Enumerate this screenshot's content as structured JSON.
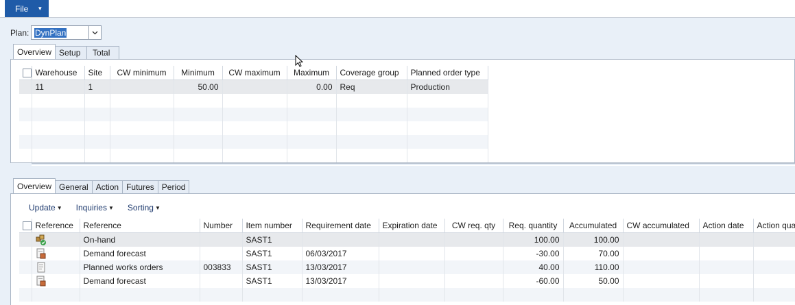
{
  "menu": {
    "file_label": "File"
  },
  "plan": {
    "label": "Plan:",
    "value": "DynPlan"
  },
  "top_tabs": [
    "Overview",
    "Setup",
    "Total"
  ],
  "coverage_grid": {
    "columns": [
      "Warehouse",
      "Site",
      "CW minimum",
      "Minimum",
      "CW maximum",
      "Maximum",
      "Coverage group",
      "Planned order type"
    ],
    "rows": [
      {
        "warehouse": "11",
        "site": "1",
        "cw_minimum": "",
        "minimum": "50.00",
        "cw_maximum": "",
        "maximum": "0.00",
        "coverage_group": "Req",
        "planned_order_type": "Production"
      }
    ]
  },
  "bottom_tabs": [
    "Overview",
    "General",
    "Action",
    "Futures",
    "Period"
  ],
  "toolbar": {
    "update": "Update",
    "inquiries": "Inquiries",
    "sorting": "Sorting"
  },
  "transactions_grid": {
    "columns": [
      "Reference",
      "Reference",
      "Number",
      "Item number",
      "Requirement date",
      "Expiration date",
      "CW req. qty",
      "Req. quantity",
      "Accumulated",
      "CW accumulated",
      "Action date",
      "Action quar"
    ],
    "rows": [
      {
        "icon": "on-hand-icon",
        "reference": "On-hand",
        "number": "",
        "item": "SAST1",
        "req_date": "",
        "exp_date": "",
        "cw_qty": "",
        "req_qty": "100.00",
        "accumulated": "100.00",
        "cw_acc": "",
        "action_date": "",
        "action_qty": ""
      },
      {
        "icon": "demand-forecast-icon",
        "reference": "Demand forecast",
        "number": "",
        "item": "SAST1",
        "req_date": "06/03/2017",
        "exp_date": "",
        "cw_qty": "",
        "req_qty": "-30.00",
        "accumulated": "70.00",
        "cw_acc": "",
        "action_date": "",
        "action_qty": ""
      },
      {
        "icon": "planned-works-order-icon",
        "reference": "Planned works orders",
        "number": "003833",
        "item": "SAST1",
        "req_date": "13/03/2017",
        "exp_date": "",
        "cw_qty": "",
        "req_qty": "40.00",
        "accumulated": "110.00",
        "cw_acc": "",
        "action_date": "",
        "action_qty": ""
      },
      {
        "icon": "demand-forecast-icon",
        "reference": "Demand forecast",
        "number": "",
        "item": "SAST1",
        "req_date": "13/03/2017",
        "exp_date": "",
        "cw_qty": "",
        "req_qty": "-60.00",
        "accumulated": "50.00",
        "cw_acc": "",
        "action_date": "",
        "action_qty": ""
      }
    ]
  },
  "colors": {
    "file_button": "#1f5ba8",
    "background": "#e9f0f8",
    "selection": "#3371c2"
  }
}
